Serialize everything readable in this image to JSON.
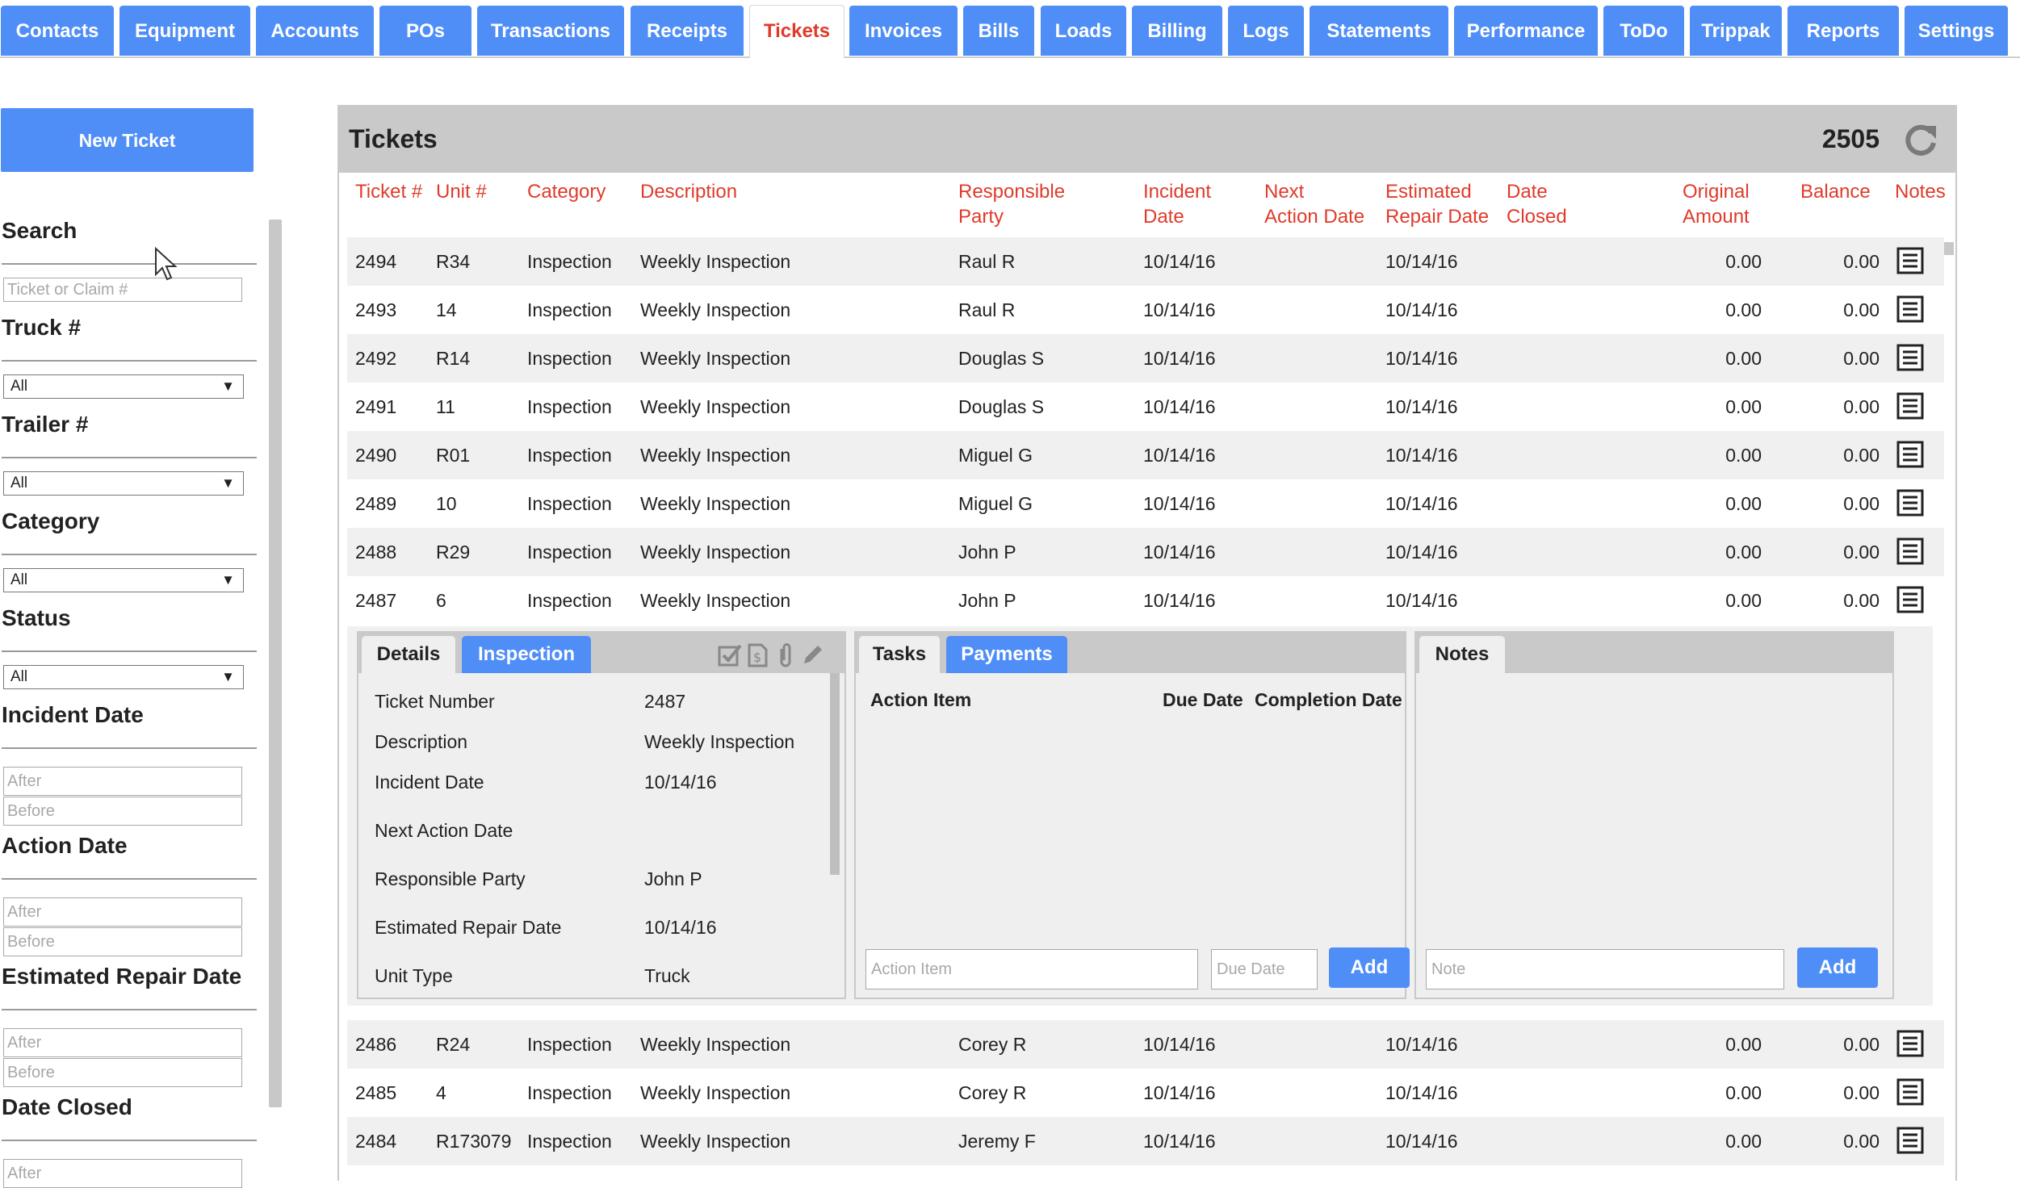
{
  "nav": {
    "tabs": [
      "Contacts",
      "Equipment",
      "Accounts",
      "POs",
      "Transactions",
      "Receipts",
      "Tickets",
      "Invoices",
      "Bills",
      "Loads",
      "Billing",
      "Logs",
      "Statements",
      "Performance",
      "ToDo",
      "Trippak",
      "Reports",
      "Settings"
    ],
    "active": "Tickets"
  },
  "sidebar": {
    "new_ticket": "New Ticket",
    "search": {
      "label": "Search",
      "placeholder": "Ticket or Claim #"
    },
    "truck": {
      "label": "Truck #",
      "value": "All"
    },
    "trailer": {
      "label": "Trailer #",
      "value": "All"
    },
    "category": {
      "label": "Category",
      "value": "All"
    },
    "status": {
      "label": "Status",
      "value": "All"
    },
    "incident_date": {
      "label": "Incident Date",
      "after": "After",
      "before": "Before"
    },
    "action_date": {
      "label": "Action Date",
      "after": "After",
      "before": "Before"
    },
    "estimated_repair_date": {
      "label": "Estimated Repair Date",
      "after": "After",
      "before": "Before"
    },
    "date_closed": {
      "label": "Date Closed",
      "after": "After"
    }
  },
  "panel": {
    "title": "Tickets",
    "count": "2505",
    "columns": {
      "ticket": "Ticket #",
      "unit": "Unit #",
      "category": "Category",
      "description": "Description",
      "responsible_1": "Responsible",
      "responsible_2": "Party",
      "incident_1": "Incident",
      "incident_2": "Date",
      "next_1": "Next",
      "next_2": "Action Date",
      "est_1": "Estimated",
      "est_2": "Repair Date",
      "closed_1": "Date",
      "closed_2": "Closed",
      "orig_1": "Original",
      "orig_2": "Amount",
      "balance": "Balance",
      "notes": "Notes"
    },
    "rows": [
      {
        "ticket": "2494",
        "unit": "R34",
        "category": "Inspection",
        "description": "Weekly Inspection",
        "party": "Raul R",
        "incident": "10/14/16",
        "next": "",
        "est": "10/14/16",
        "closed": "",
        "original": "0.00",
        "balance": "0.00"
      },
      {
        "ticket": "2493",
        "unit": "14",
        "category": "Inspection",
        "description": "Weekly Inspection",
        "party": "Raul R",
        "incident": "10/14/16",
        "next": "",
        "est": "10/14/16",
        "closed": "",
        "original": "0.00",
        "balance": "0.00"
      },
      {
        "ticket": "2492",
        "unit": "R14",
        "category": "Inspection",
        "description": "Weekly Inspection",
        "party": "Douglas S",
        "incident": "10/14/16",
        "next": "",
        "est": "10/14/16",
        "closed": "",
        "original": "0.00",
        "balance": "0.00"
      },
      {
        "ticket": "2491",
        "unit": "11",
        "category": "Inspection",
        "description": "Weekly Inspection",
        "party": "Douglas S",
        "incident": "10/14/16",
        "next": "",
        "est": "10/14/16",
        "closed": "",
        "original": "0.00",
        "balance": "0.00"
      },
      {
        "ticket": "2490",
        "unit": "R01",
        "category": "Inspection",
        "description": "Weekly Inspection",
        "party": "Miguel G",
        "incident": "10/14/16",
        "next": "",
        "est": "10/14/16",
        "closed": "",
        "original": "0.00",
        "balance": "0.00"
      },
      {
        "ticket": "2489",
        "unit": "10",
        "category": "Inspection",
        "description": "Weekly Inspection",
        "party": "Miguel G",
        "incident": "10/14/16",
        "next": "",
        "est": "10/14/16",
        "closed": "",
        "original": "0.00",
        "balance": "0.00"
      },
      {
        "ticket": "2488",
        "unit": "R29",
        "category": "Inspection",
        "description": "Weekly Inspection",
        "party": "John P",
        "incident": "10/14/16",
        "next": "",
        "est": "10/14/16",
        "closed": "",
        "original": "0.00",
        "balance": "0.00"
      },
      {
        "ticket": "2487",
        "unit": "6",
        "category": "Inspection",
        "description": "Weekly Inspection",
        "party": "John P",
        "incident": "10/14/16",
        "next": "",
        "est": "10/14/16",
        "closed": "",
        "original": "0.00",
        "balance": "0.00"
      }
    ],
    "rows_after": [
      {
        "ticket": "2486",
        "unit": "R24",
        "category": "Inspection",
        "description": "Weekly Inspection",
        "party": "Corey R",
        "incident": "10/14/16",
        "next": "",
        "est": "10/14/16",
        "closed": "",
        "original": "0.00",
        "balance": "0.00"
      },
      {
        "ticket": "2485",
        "unit": "4",
        "category": "Inspection",
        "description": "Weekly Inspection",
        "party": "Corey R",
        "incident": "10/14/16",
        "next": "",
        "est": "10/14/16",
        "closed": "",
        "original": "0.00",
        "balance": "0.00"
      },
      {
        "ticket": "2484",
        "unit": "R173079",
        "category": "Inspection",
        "description": "Weekly Inspection",
        "party": "Jeremy F",
        "incident": "10/14/16",
        "next": "",
        "est": "10/14/16",
        "closed": "",
        "original": "0.00",
        "balance": "0.00"
      }
    ]
  },
  "detail": {
    "tabs": {
      "details": "Details",
      "inspection": "Inspection"
    },
    "fields": [
      {
        "label": "Ticket Number",
        "value": "2487"
      },
      {
        "label": "Description",
        "value": "Weekly Inspection"
      },
      {
        "label": "Incident Date",
        "value": "10/14/16"
      },
      {
        "label": "Next Action Date",
        "value": ""
      },
      {
        "label": "Responsible Party",
        "value": "John P"
      },
      {
        "label": "Estimated Repair Date",
        "value": "10/14/16"
      },
      {
        "label": "Unit Type",
        "value": "Truck"
      }
    ],
    "tasks": {
      "tab": "Tasks",
      "payments_tab": "Payments",
      "col_action": "Action Item",
      "col_due": "Due Date",
      "col_completion": "Completion Date",
      "action_placeholder": "Action Item",
      "due_placeholder": "Due Date",
      "add": "Add"
    },
    "notes": {
      "tab": "Notes",
      "placeholder": "Note",
      "add": "Add"
    }
  },
  "colors": {
    "accent": "#4f8ef7",
    "header_text": "#e03a2a",
    "panel_header": "#c9c9c9",
    "row_alt": "#f0f0f0"
  }
}
